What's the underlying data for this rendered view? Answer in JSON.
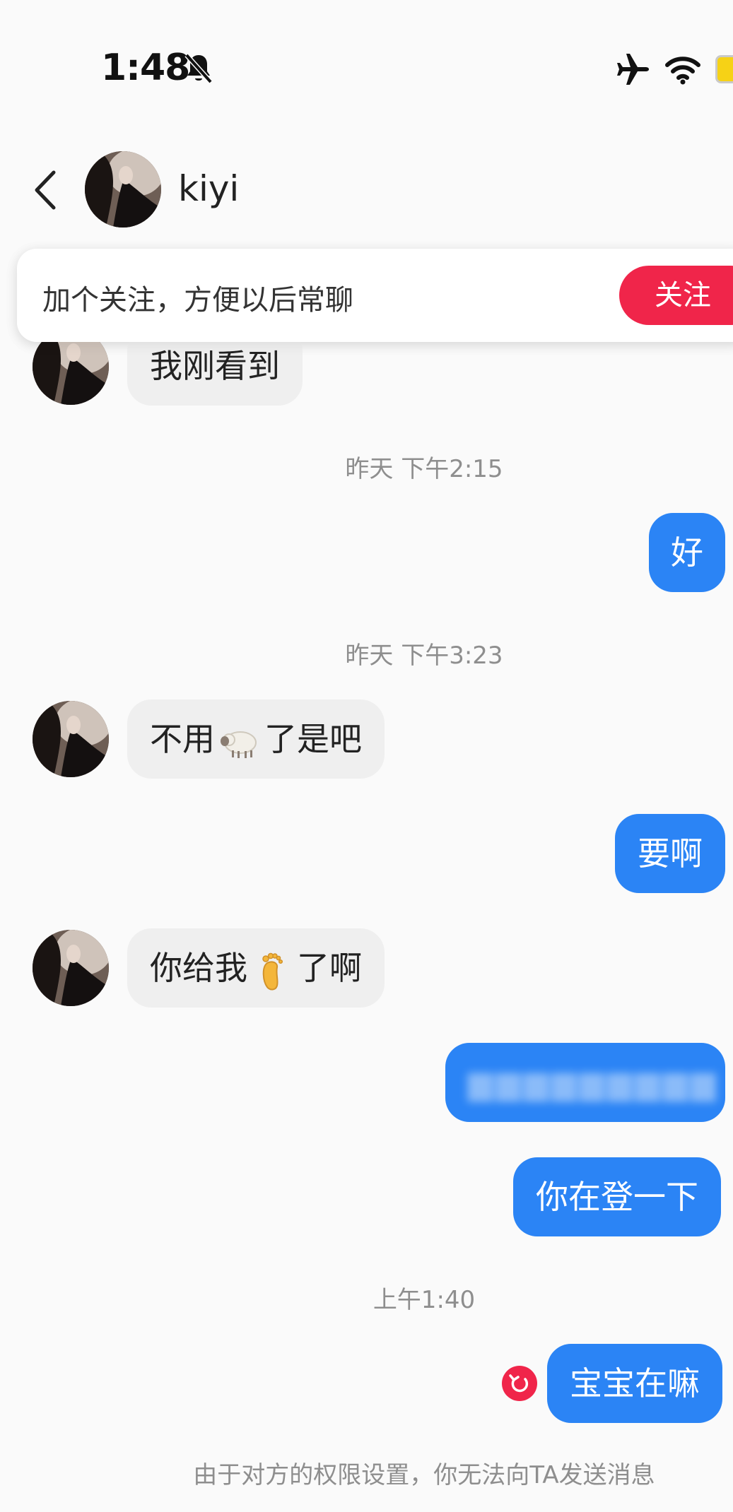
{
  "status_bar": {
    "time": "1:48",
    "icons": [
      "bell-off-icon",
      "airplane-icon",
      "wifi-icon",
      "battery-icon"
    ],
    "battery_color": "#f6d216"
  },
  "header": {
    "contact_name": "kiyi",
    "back_icon": "chevron-left-icon"
  },
  "follow_banner": {
    "text": "加个关注，方便以后常聊",
    "button_label": "关注",
    "button_color": "#f0254a"
  },
  "messages": [
    {
      "direction": "incoming",
      "text": "我刚看到"
    },
    {
      "type": "timestamp",
      "text": "昨天 下午2:15"
    },
    {
      "direction": "outgoing",
      "text": "好"
    },
    {
      "type": "timestamp",
      "text": "昨天 下午3:23"
    },
    {
      "direction": "incoming",
      "text_before": "不用",
      "emoji": "sheep-emoji",
      "text_after": "了是吧"
    },
    {
      "direction": "outgoing",
      "text": "要啊"
    },
    {
      "direction": "incoming",
      "text_before": "你给我",
      "emoji": "foot-emoji",
      "text_after": "了啊"
    },
    {
      "direction": "outgoing",
      "blurred": true
    },
    {
      "direction": "outgoing",
      "text": "你在登一下"
    },
    {
      "type": "timestamp",
      "text": "上午1:40"
    },
    {
      "direction": "outgoing",
      "text": "宝宝在嘛",
      "failed": true
    }
  ],
  "notice": "由于对方的权限设置，你无法向TA发送消息",
  "colors": {
    "outgoing_bubble": "#2b84f5",
    "incoming_bubble": "#efefef",
    "background": "#fafafa"
  }
}
